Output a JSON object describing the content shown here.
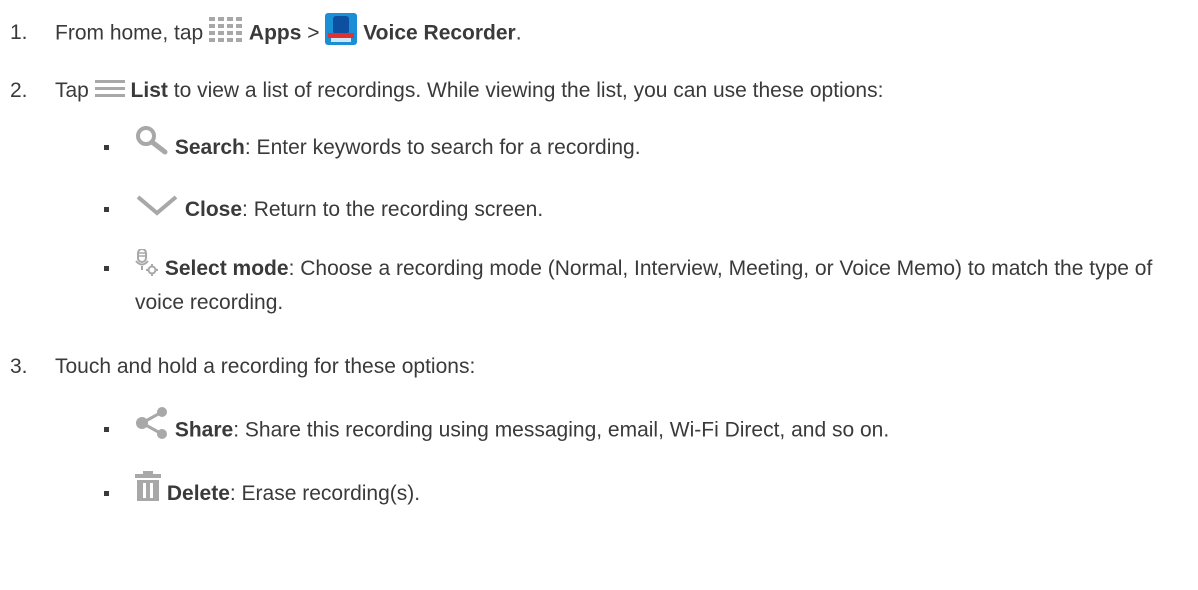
{
  "steps": [
    {
      "number": "1.",
      "pre": "From home, tap",
      "apps_label": "Apps",
      "sep": ">",
      "recorder_label": "Voice Recorder",
      "end": "."
    },
    {
      "number": "2.",
      "pre": "Tap",
      "list_label": "List",
      "post": "to view a list of recordings. While viewing the list, you can use these options:",
      "options": [
        {
          "icon": "search-icon",
          "label": "Search",
          "text": ": Enter keywords to search for a recording."
        },
        {
          "icon": "chevron-down-icon",
          "label": "Close",
          "text": ": Return to the recording screen."
        },
        {
          "icon": "select-mode-icon",
          "label": "Select mode",
          "text": ": Choose a recording mode (Normal, Interview, Meeting, or Voice Memo) to match the type of voice recording."
        }
      ]
    },
    {
      "number": "3.",
      "text": "Touch and hold a recording for these options:",
      "options": [
        {
          "icon": "share-icon",
          "label": "Share",
          "text": ": Share this recording using messaging, email, Wi-Fi Direct, and so on."
        },
        {
          "icon": "trash-icon",
          "label": "Delete",
          "text": ": Erase recording(s)."
        }
      ]
    }
  ],
  "colors": {
    "text": "#3a3a3a",
    "icon_gray": "#a8a8a8",
    "recorder_blue": "#1a8fd6",
    "recorder_red": "#e03030"
  }
}
